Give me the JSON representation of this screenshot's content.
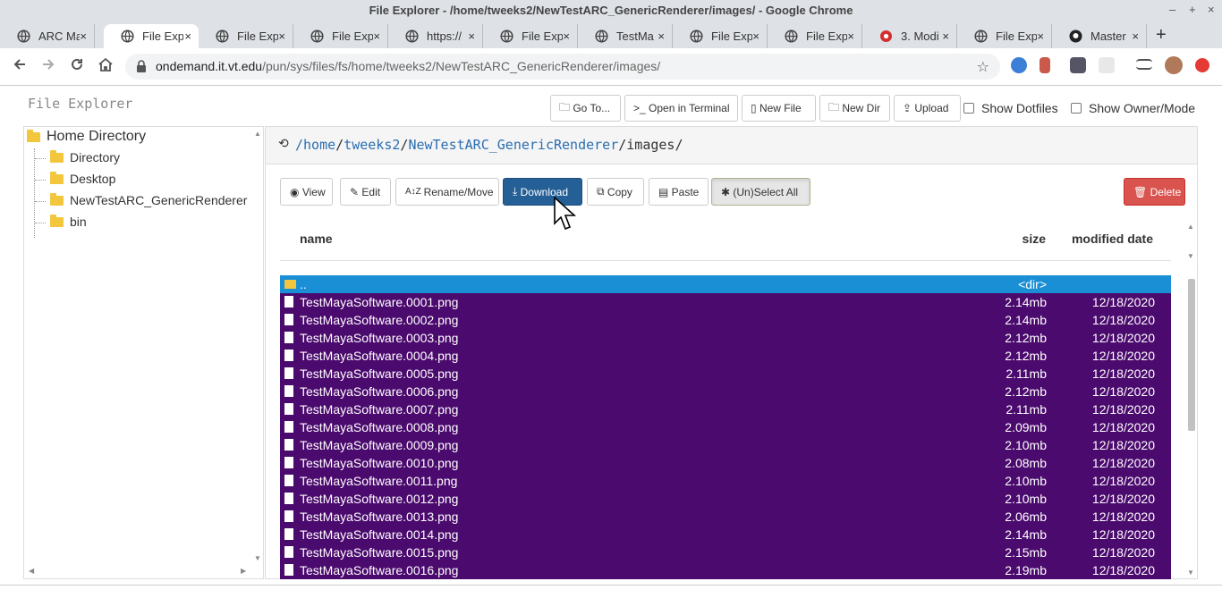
{
  "window": {
    "title": "File Explorer - /home/tweeks2/NewTestARC_GenericRenderer/images/ - Google Chrome",
    "minimize": "–",
    "maximize": "+",
    "close": "×"
  },
  "tabs": [
    {
      "label": "ARC Ma",
      "icon": "globe-icon"
    },
    {
      "label": "File Exp",
      "icon": "globe-icon",
      "active": true
    },
    {
      "label": "File Exp",
      "icon": "globe-icon"
    },
    {
      "label": "File Exp",
      "icon": "globe-icon"
    },
    {
      "label": "https://",
      "icon": "globe-icon"
    },
    {
      "label": "File Exp",
      "icon": "globe-icon"
    },
    {
      "label": "TestMa",
      "icon": "globe-icon"
    },
    {
      "label": "File Exp",
      "icon": "globe-icon"
    },
    {
      "label": "File Exp",
      "icon": "globe-icon"
    },
    {
      "label": "3. Modi",
      "icon": "red-circle-icon"
    },
    {
      "label": "File Exp",
      "icon": "globe-icon"
    },
    {
      "label": "Master",
      "icon": "github-icon"
    }
  ],
  "tab_close": "×",
  "new_tab": "+",
  "address": {
    "host": "ondemand.it.vt.edu",
    "path": "/pun/sys/files/fs/home/tweeks2/NewTestARC_GenericRenderer/images/"
  },
  "app": {
    "brand": "File Explorer",
    "top_buttons": {
      "goto": "Go To...",
      "terminal": "Open in Terminal",
      "newfile": "New File",
      "newdir": "New Dir",
      "upload": "Upload"
    },
    "show_dotfiles": "Show Dotfiles",
    "show_owner": "Show Owner/Mode"
  },
  "tree": {
    "root": "Home Directory",
    "items": [
      "Directory",
      "Desktop",
      "NewTestARC_GenericRenderer",
      "bin"
    ]
  },
  "path": {
    "segments": [
      "/home",
      "tweeks2",
      "NewTestARC_GenericRenderer"
    ],
    "current": "images/"
  },
  "actions": {
    "view": "View",
    "edit": "Edit",
    "rename": "Rename/Move",
    "download": "Download",
    "copy": "Copy",
    "paste": "Paste",
    "select_all": "(Un)Select All",
    "delete": "Delete"
  },
  "table": {
    "headers": {
      "name": "name",
      "size": "size",
      "date": "modified date"
    },
    "parent": {
      "name": "..",
      "size": "<dir>",
      "date": ""
    },
    "rows": [
      {
        "name": "TestMayaSoftware.0001.png",
        "size": "2.14mb",
        "date": "12/18/2020"
      },
      {
        "name": "TestMayaSoftware.0002.png",
        "size": "2.14mb",
        "date": "12/18/2020"
      },
      {
        "name": "TestMayaSoftware.0003.png",
        "size": "2.12mb",
        "date": "12/18/2020"
      },
      {
        "name": "TestMayaSoftware.0004.png",
        "size": "2.12mb",
        "date": "12/18/2020"
      },
      {
        "name": "TestMayaSoftware.0005.png",
        "size": "2.11mb",
        "date": "12/18/2020"
      },
      {
        "name": "TestMayaSoftware.0006.png",
        "size": "2.12mb",
        "date": "12/18/2020"
      },
      {
        "name": "TestMayaSoftware.0007.png",
        "size": "2.11mb",
        "date": "12/18/2020"
      },
      {
        "name": "TestMayaSoftware.0008.png",
        "size": "2.09mb",
        "date": "12/18/2020"
      },
      {
        "name": "TestMayaSoftware.0009.png",
        "size": "2.10mb",
        "date": "12/18/2020"
      },
      {
        "name": "TestMayaSoftware.0010.png",
        "size": "2.08mb",
        "date": "12/18/2020"
      },
      {
        "name": "TestMayaSoftware.0011.png",
        "size": "2.10mb",
        "date": "12/18/2020"
      },
      {
        "name": "TestMayaSoftware.0012.png",
        "size": "2.10mb",
        "date": "12/18/2020"
      },
      {
        "name": "TestMayaSoftware.0013.png",
        "size": "2.06mb",
        "date": "12/18/2020"
      },
      {
        "name": "TestMayaSoftware.0014.png",
        "size": "2.14mb",
        "date": "12/18/2020"
      },
      {
        "name": "TestMayaSoftware.0015.png",
        "size": "2.15mb",
        "date": "12/18/2020"
      },
      {
        "name": "TestMayaSoftware.0016.png",
        "size": "2.19mb",
        "date": "12/18/2020"
      }
    ]
  },
  "colors": {
    "selected_row": "#4b0a6e",
    "parent_row": "#1a8fd6",
    "primary_button": "#245f96",
    "danger_button": "#d9534f",
    "link": "#2a6eb1"
  }
}
